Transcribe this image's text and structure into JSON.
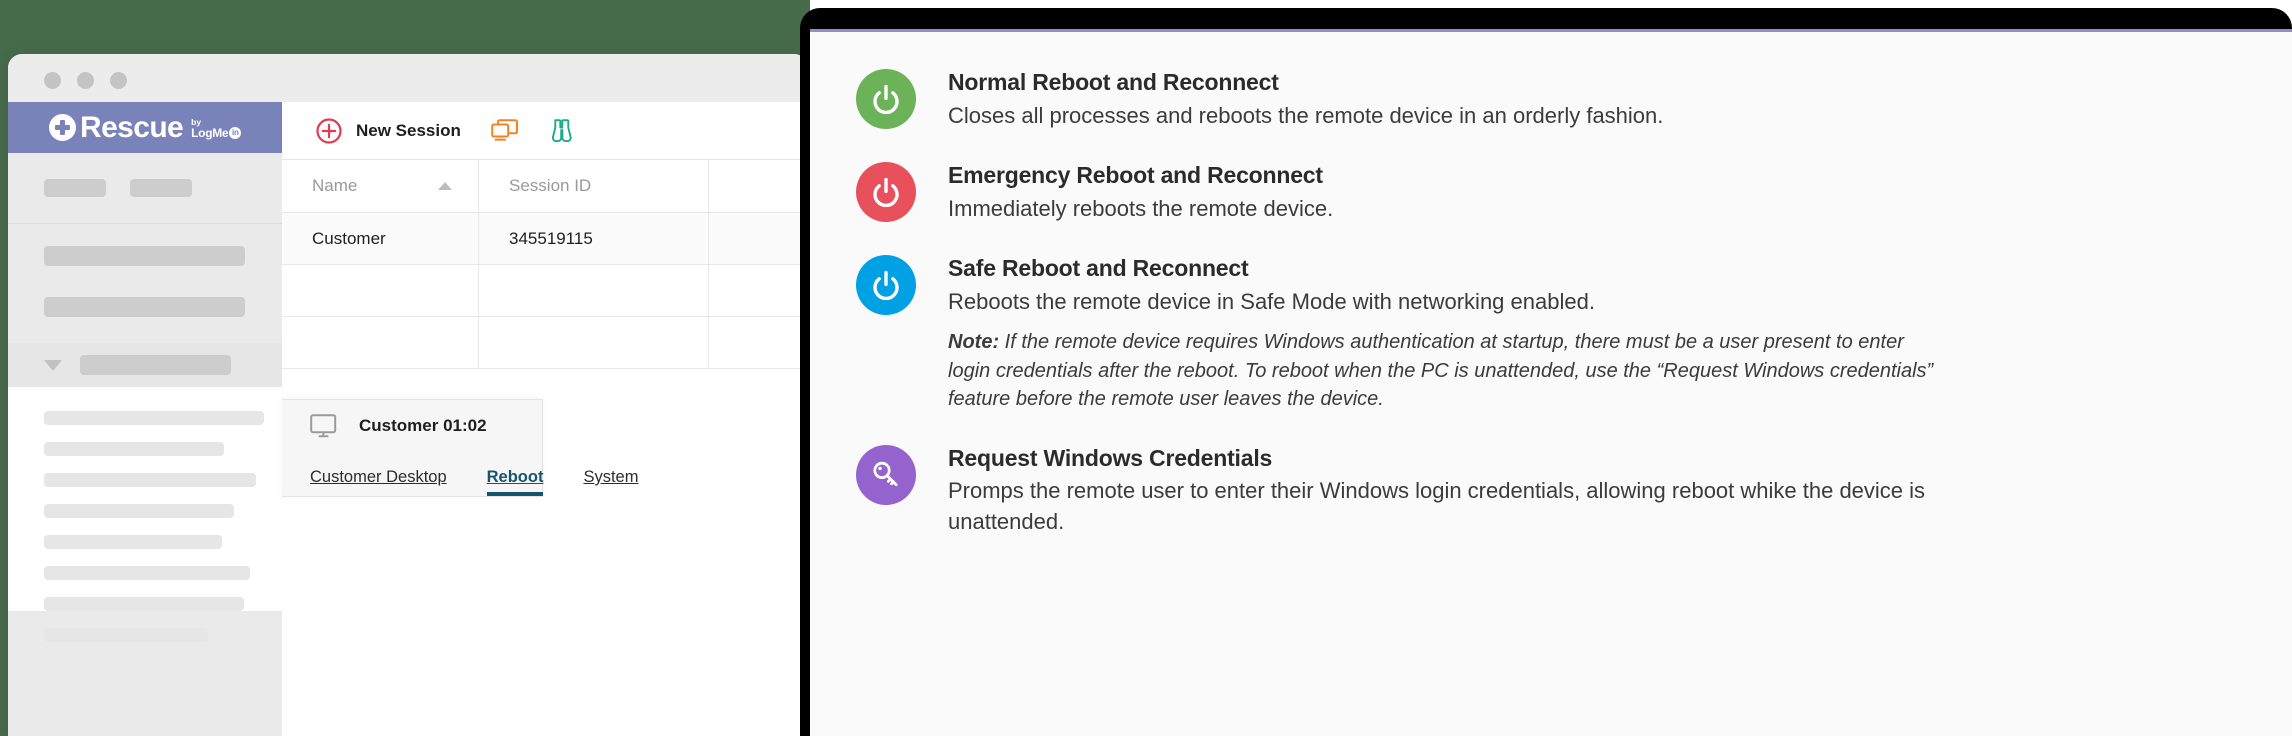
{
  "colors": {
    "brand_purple": "#7982b9",
    "green": "#6cb259",
    "red": "#e8505b",
    "blue": "#00a0e4",
    "violet": "#9463ce",
    "accent_teal": "#17556f",
    "toolbar_orange": "#f58220",
    "toolbar_green": "#1aab8a",
    "backdrop_green": "#466b4b"
  },
  "browser": {
    "traffic_lights": [
      "close-dot",
      "minimize-dot",
      "maximize-dot"
    ],
    "sidebar": {
      "brand": {
        "name": "Rescue",
        "by": "by",
        "company": "LogMe",
        "company_suffix": "in"
      }
    },
    "toolbar": {
      "new_session_label": "New Session",
      "icons": [
        "plus-circle-icon",
        "screen-share-icon",
        "binoculars-icon"
      ]
    },
    "table": {
      "columns": [
        "Name",
        "Session ID"
      ],
      "sort_column": "Name",
      "sort_direction": "asc",
      "rows": [
        {
          "name": "Customer",
          "session_id": "345519115"
        },
        {
          "name": "",
          "session_id": ""
        },
        {
          "name": "",
          "session_id": ""
        }
      ]
    },
    "session_panel": {
      "icon": "monitor-icon",
      "title": "Customer 01:02",
      "tabs": [
        {
          "label": "Customer Desktop",
          "active": false
        },
        {
          "label": "Reboot",
          "active": true
        },
        {
          "label": "System",
          "active": false
        }
      ]
    }
  },
  "panel": {
    "features": [
      {
        "icon": "power-icon",
        "color": "#6cb259",
        "title": "Normal Reboot and Reconnect",
        "desc": "Closes all processes and reboots the remote device in an orderly fashion.",
        "note": null
      },
      {
        "icon": "power-icon",
        "color": "#e8505b",
        "title": "Emergency Reboot and Reconnect",
        "desc": "Immediately reboots the remote device.",
        "note": null
      },
      {
        "icon": "power-icon",
        "color": "#00a0e4",
        "title": "Safe Reboot and Reconnect",
        "desc": "Reboots the remote device in Safe Mode with networking enabled.",
        "note_label": "Note:",
        "note": " If the remote device requires Windows authentication at startup, there must be a user present to enter login credentials after the reboot. To reboot when the PC is unattended, use the “Request Windows credentials” feature before the remote user leaves the device."
      },
      {
        "icon": "key-icon",
        "color": "#9463ce",
        "title": "Request Windows Credentials",
        "desc": "Promps the remote user to enter their Windows login credentials, allowing reboot whike the device is unattended.",
        "note": null
      }
    ]
  }
}
